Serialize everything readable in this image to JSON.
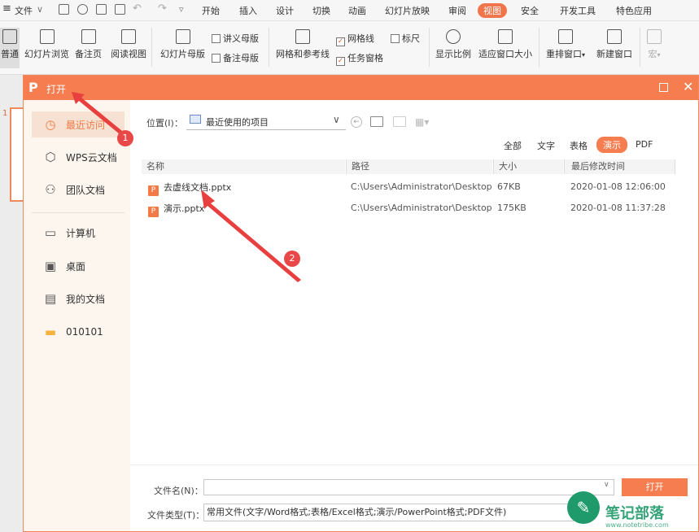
{
  "menubar": {
    "file_label": "文件",
    "items": [
      "开始",
      "插入",
      "设计",
      "切换",
      "动画",
      "幻灯片放映",
      "审阅",
      "视图",
      "安全",
      "开发工具",
      "特色应用"
    ],
    "active_index": 7
  },
  "ribbon": {
    "normal": "普通",
    "slide_browse": "幻灯片浏览",
    "notes_page": "备注页",
    "reading_view": "阅读视图",
    "slide_master": "幻灯片母版",
    "handout_master": "讲义母版",
    "notes_master": "备注母版",
    "grid_guides": "网格和参考线",
    "gridlines": "网格线",
    "ruler": "标尺",
    "task_pane": "任务窗格",
    "zoom": "显示比例",
    "fit_window": "适应窗口大小",
    "arrange_windows": "重排窗口",
    "new_window": "新建窗口",
    "macro": "宏"
  },
  "thumb_number": "1",
  "dialog": {
    "title": "打开",
    "sidebar": {
      "recent": "最近访问",
      "wps_cloud": "WPS云文档",
      "team_docs": "团队文档",
      "computer": "计算机",
      "desktop": "桌面",
      "my_docs": "我的文档",
      "folder": "010101"
    },
    "location_label": "位置(I)：",
    "location_value": "最近使用的项目",
    "filters": [
      "全部",
      "文字",
      "表格",
      "演示",
      "PDF"
    ],
    "active_filter": 3,
    "columns": {
      "name": "名称",
      "path": "路径",
      "size": "大小",
      "modified": "最后修改时间"
    },
    "files": [
      {
        "name": "去虚线文档.pptx",
        "path": "C:\\Users\\Administrator\\Desktop",
        "size": "67KB",
        "modified": "2020-01-08 12:06:00"
      },
      {
        "name": "演示.pptx",
        "path": "C:\\Users\\Administrator\\Desktop",
        "size": "175KB",
        "modified": "2020-01-08 11:37:28"
      }
    ],
    "filename_label": "文件名(N)：",
    "filename_value": "",
    "filetype_label": "文件类型(T)：",
    "filetype_value": "常用文件(文字/Word格式;表格/Excel格式;演示/PowerPoint格式;PDF文件)",
    "open_button": "打开"
  },
  "annotations": {
    "badge1": "1",
    "badge2": "2"
  },
  "watermark": {
    "text": "笔记部落",
    "url": "www.notetribe.com"
  },
  "colors": {
    "accent": "#f57d4f",
    "arrow": "#e83f3f"
  }
}
